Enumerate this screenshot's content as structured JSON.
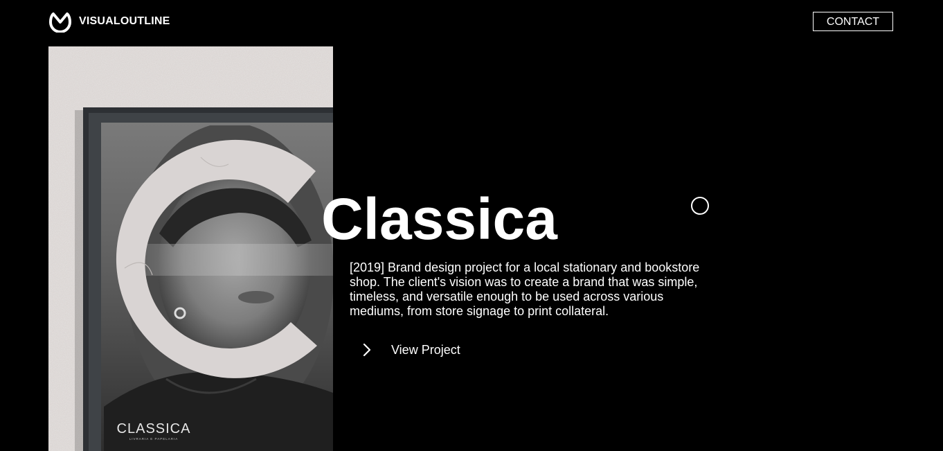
{
  "header": {
    "logo_text": "VISUALOUTLINE",
    "logo_icon": "m-circle-logo-icon",
    "contact_label": "CONTACT"
  },
  "hero": {
    "image": {
      "description_icon": "poster-frame-image",
      "poster_brand_text": "CLASSICA",
      "poster_subtext": "LIVRARIA E PAPELARIA"
    },
    "title": "Classica",
    "description": "[2019] Brand design project for a local stationary and bookstore shop. The client's vision was to create a brand that was simple, timeless, and versatile enough to be used across various mediums, from store signage to print collateral.",
    "cta": {
      "label": "View Project",
      "icon": "chevron-right-icon"
    }
  },
  "colors": {
    "background": "#000000",
    "text": "#ffffff",
    "wall": "#ddd8d6",
    "frame": "#2c2f33",
    "poster": "#5a5a5a"
  }
}
